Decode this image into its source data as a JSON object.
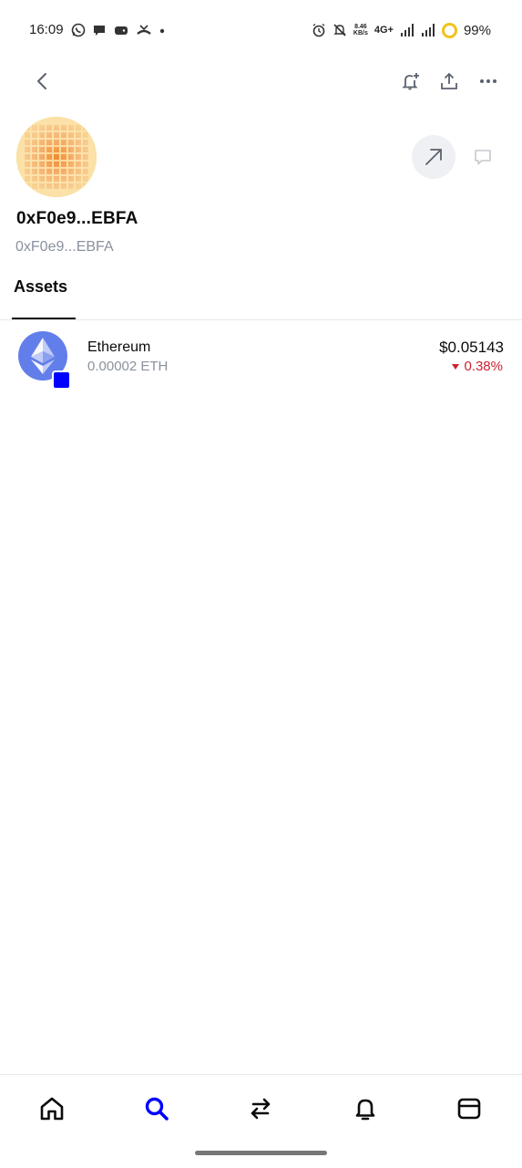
{
  "status_bar": {
    "time": "16:09",
    "speed_value": "8.46",
    "speed_unit": "KB/s",
    "network": "4G+",
    "battery": "99%"
  },
  "header": {
    "back_icon": "chevron-left-icon",
    "actions": [
      "bell-plus-icon",
      "share-icon",
      "more-icon"
    ]
  },
  "profile": {
    "name": "0xF0e9...EBFA",
    "address": "0xF0e9...EBFA",
    "actions": [
      "send-arrow-icon",
      "chat-icon"
    ]
  },
  "tabs": [
    {
      "label": "Assets",
      "active": true
    }
  ],
  "assets": [
    {
      "name": "Ethereum",
      "amount": "0.00002 ETH",
      "value": "$0.05143",
      "change": "0.38%",
      "change_direction": "down",
      "icon": "ethereum-icon",
      "color": "#627eea"
    }
  ],
  "bottom_nav": {
    "items": [
      "home-icon",
      "search-icon",
      "swap-icon",
      "bell-icon",
      "wallet-icon"
    ],
    "active": "search-icon"
  },
  "colors": {
    "accent": "#0000ff",
    "negative": "#cf202f",
    "secondary_text": "#8a919e"
  }
}
